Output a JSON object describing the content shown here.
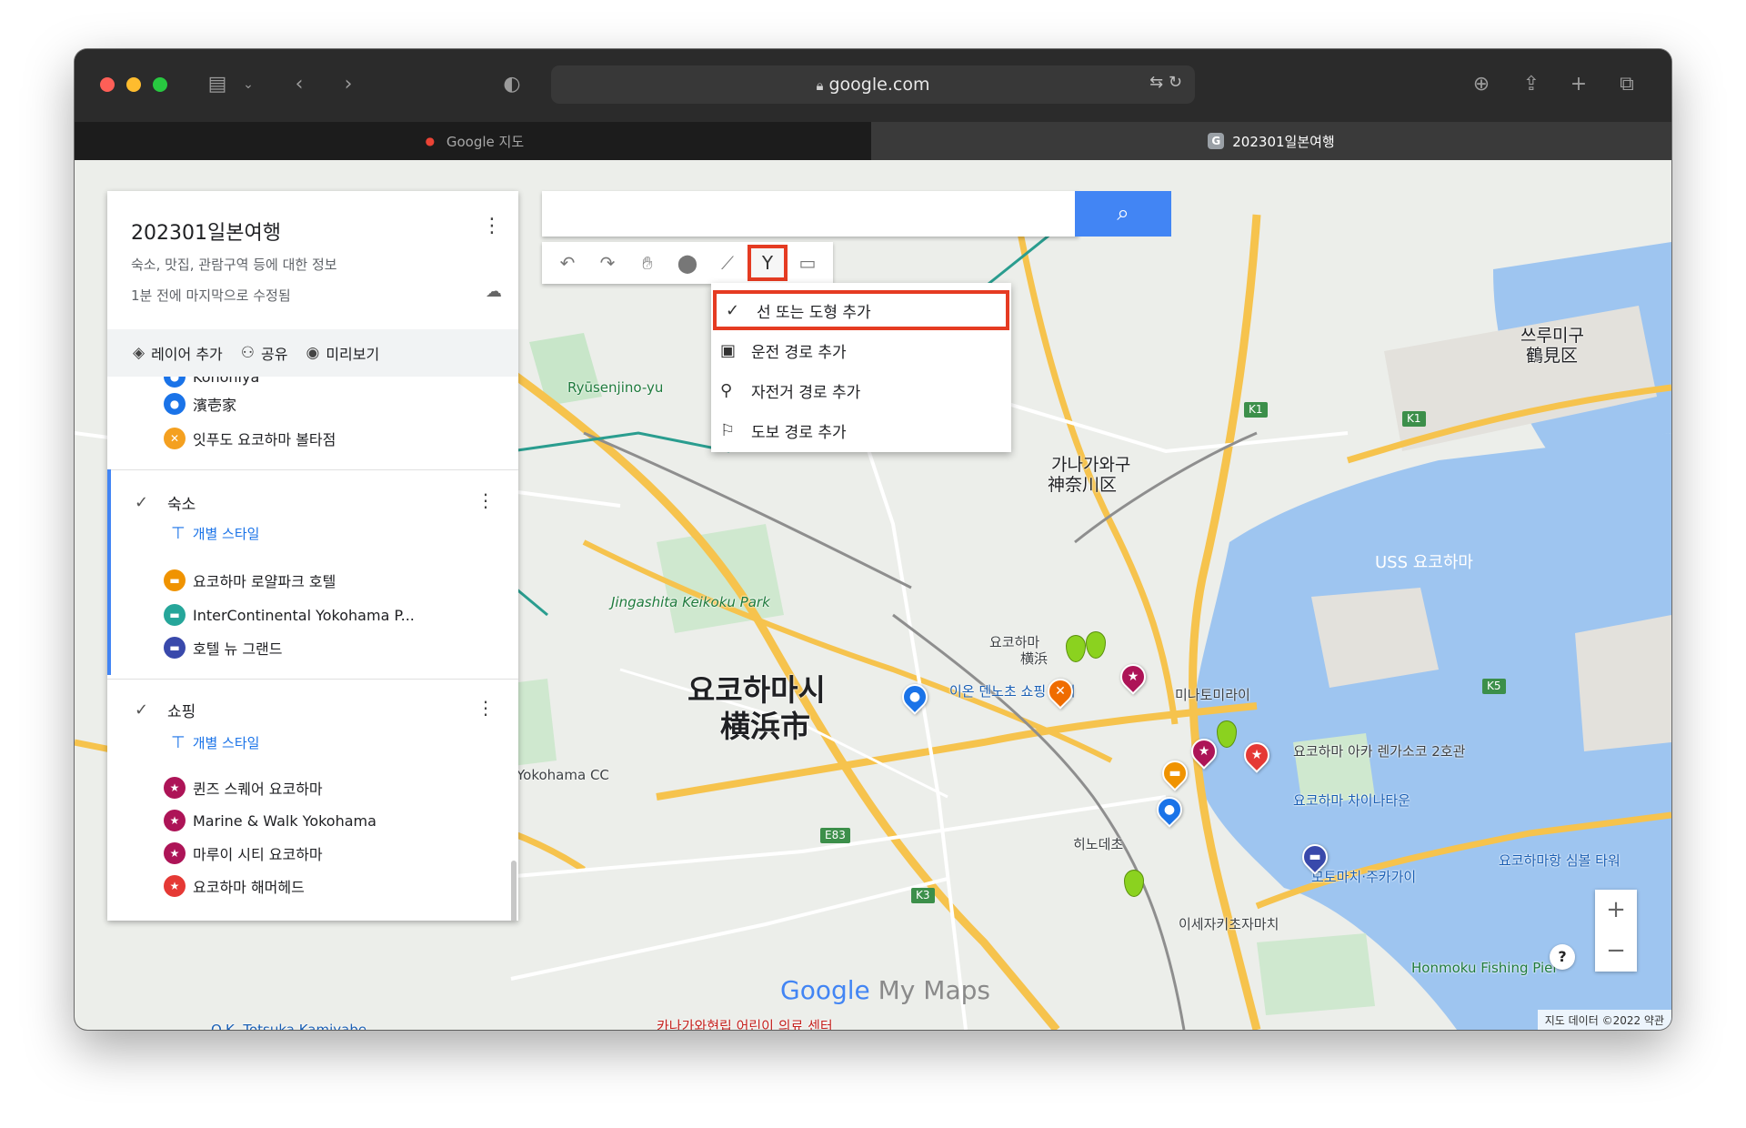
{
  "browser": {
    "url": "google.com",
    "tabs": [
      {
        "label": "Google 지도",
        "favicon": "google-maps-pin-icon",
        "active": false
      },
      {
        "label": "202301일본여행",
        "favicon": "google-g-icon",
        "active": true
      }
    ]
  },
  "map": {
    "search_placeholder": "",
    "dropdown": {
      "items": [
        {
          "label": "선 또는 도형 추가",
          "icon": "checkmark-icon",
          "selected": true
        },
        {
          "label": "운전 경로 추가",
          "icon": "car-icon",
          "selected": false
        },
        {
          "label": "자전거 경로 추가",
          "icon": "bicycle-icon",
          "selected": false
        },
        {
          "label": "도보 경로 추가",
          "icon": "walking-icon",
          "selected": false
        }
      ]
    },
    "labels": {
      "city_ko": "요코하마시",
      "city_ja": "横浜市",
      "kanagawa": "가나가와구",
      "kanagawa_ja": "神奈川区",
      "tsurumi": "쓰루미구",
      "tsurumi_ja": "鶴見区",
      "usscoast": "USS 요코하마",
      "chinatown": "요코하마 차이나타운",
      "yokohama_station": "요코하마",
      "yokohama_station_ja": "横浜",
      "honmoku": "Honmoku Fishing Pier",
      "jingasaki": "Jingashita Keikoku Park",
      "ryusenjino": "Ryūsenjino-yu",
      "otsuka": "O.K. Totsuka Kamiyabe",
      "minato": "미나토미라이",
      "aeon": "이온 덴노초 쇼핑 센터",
      "hinodecho": "히노데초",
      "isezaki": "이세자키초자마치",
      "tomoda": "카나가와현립 어린이 의료 센터",
      "redbrick": "요코하마 아카 렌가소코 2호관",
      "yokohamacc": "Yokohama CC",
      "tower": "요코하마항 심볼 타워",
      "motomachi": "모토마치·주카가이"
    },
    "zoom_in": "+",
    "zoom_out": "−",
    "help": "?",
    "watermark_google": "Google",
    "watermark_mymaps": " My Maps",
    "copyright": "지도 데이터 ©2022 약관"
  },
  "panel": {
    "title": "202301일본여행",
    "description": "숙소, 맛집, 관람구역 등에 대한 정보",
    "saved_status": "1분 전에 마지막으로 수정됨",
    "actions": [
      {
        "label": "레이어 추가",
        "icon": "layers-icon"
      },
      {
        "label": "공유",
        "icon": "add-person-icon"
      },
      {
        "label": "미리보기",
        "icon": "eye-icon"
      }
    ],
    "top_items": [
      {
        "label": "Konohiya",
        "color": "#1a73e8"
      },
      {
        "label": "濱壱家",
        "color": "#1a73e8"
      },
      {
        "label": "잇푸도 요코하마 볼타점",
        "color": "#f4a020"
      }
    ],
    "layers": [
      {
        "name": "숙소",
        "style_label": "개별 스타일",
        "items": [
          {
            "label": "요코하마 로얄파크 호텔",
            "color": "#f09300"
          },
          {
            "label": "InterContinental Yokohama P...",
            "color": "#26a69a"
          },
          {
            "label": "호텔 뉴 그랜드",
            "color": "#3949ab"
          }
        ]
      },
      {
        "name": "쇼핑",
        "style_label": "개별 스타일",
        "items": [
          {
            "label": "퀸즈 스퀘어 요코하마",
            "color": "#ad1457"
          },
          {
            "label": "Marine & Walk Yokohama",
            "color": "#ad1457"
          },
          {
            "label": "마루이 시티 요코하마",
            "color": "#ad1457"
          },
          {
            "label": "요코하마 해머헤드",
            "color": "#e53935"
          }
        ]
      }
    ]
  }
}
